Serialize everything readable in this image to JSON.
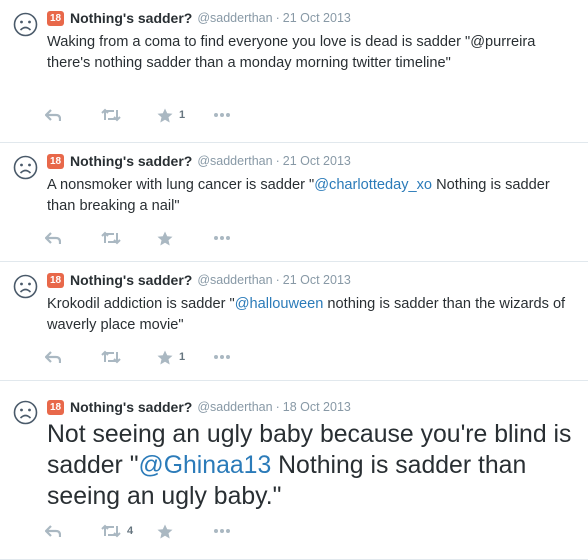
{
  "tweets": [
    {
      "badge": "18",
      "fullname": "Nothing's sadder?",
      "username": "@sadderthan",
      "separator": "·",
      "time": "21 Oct 2013",
      "text_parts": [
        "Waking from a coma to find everyone you love is dead is sadder \"@purreira there's nothing sadder than a monday morning twitter timeline\"",
        "",
        ""
      ],
      "retweet_count": "",
      "favorite_count": "1"
    },
    {
      "badge": "18",
      "fullname": "Nothing's sadder?",
      "username": "@sadderthan",
      "separator": "·",
      "time": "21 Oct 2013",
      "text_parts": [
        "A nonsmoker with lung cancer is sadder \"",
        "@charlotteday_xo",
        " Nothing is sadder than breaking a nail\""
      ],
      "retweet_count": "",
      "favorite_count": ""
    },
    {
      "badge": "18",
      "fullname": "Nothing's sadder?",
      "username": "@sadderthan",
      "separator": "·",
      "time": "21 Oct 2013",
      "text_parts": [
        "Krokodil addiction is sadder \"",
        "@hallouween",
        " nothing is sadder than the wizards of waverly place movie\""
      ],
      "retweet_count": "",
      "favorite_count": "1"
    },
    {
      "badge": "18",
      "fullname": "Nothing's sadder?",
      "username": "@sadderthan",
      "separator": "·",
      "time": "18 Oct 2013",
      "text_parts": [
        "Not seeing an ugly baby because you're blind is sadder \"",
        "@Ghinaa13",
        " Nothing is sadder than seeing an ugly baby.\""
      ],
      "retweet_count": "4",
      "favorite_count": ""
    }
  ],
  "icons": {
    "avatar": "sad-face-icon",
    "reply": "reply-icon",
    "retweet": "retweet-icon",
    "favorite": "star-icon",
    "more": "more-icon"
  },
  "colors": {
    "badge": "#e8684a",
    "mention": "#2b7bb9",
    "muted": "#8899a6",
    "action": "#aab8c2"
  }
}
